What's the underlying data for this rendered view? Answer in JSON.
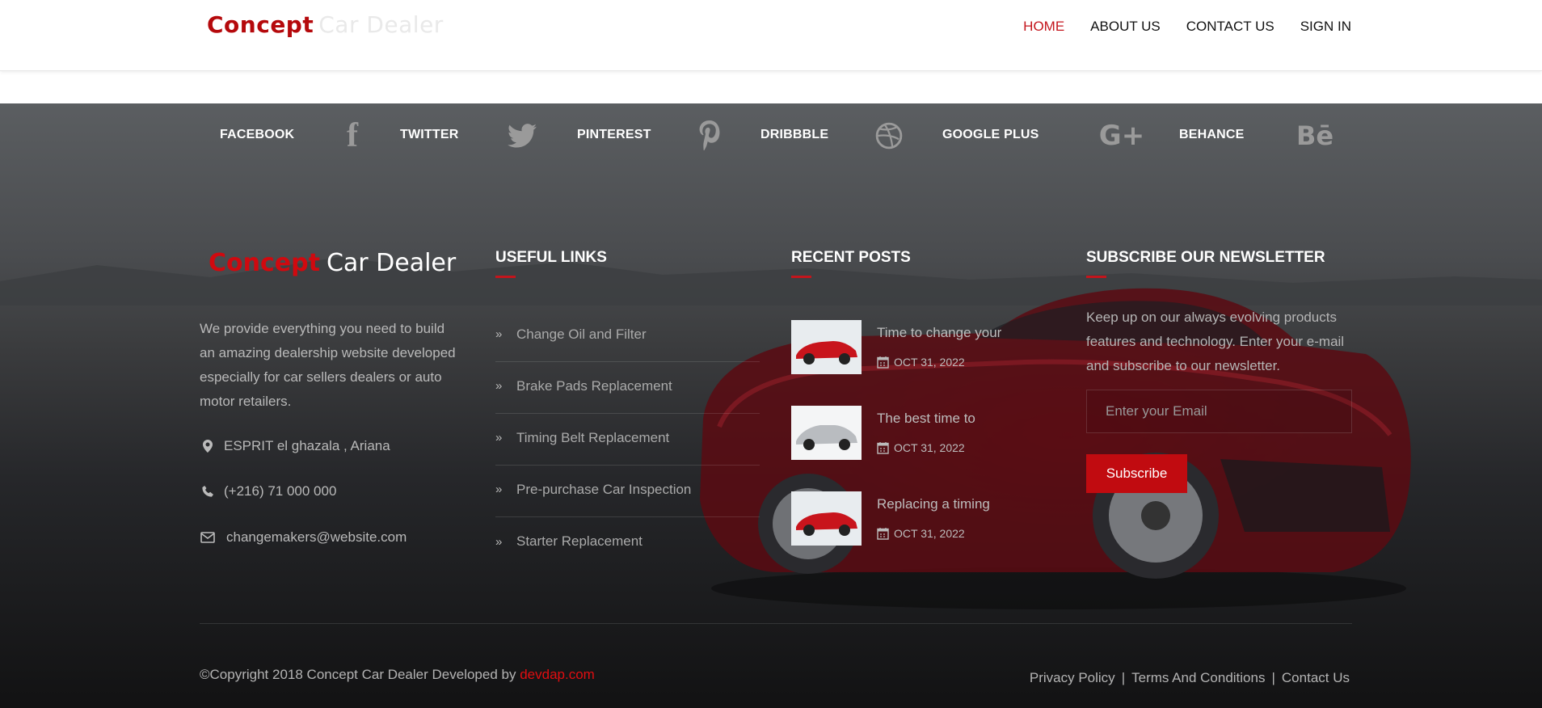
{
  "header": {
    "logo_primary": "Concept",
    "logo_secondary": "Car Dealer",
    "nav": [
      {
        "label": "HOME",
        "active": true
      },
      {
        "label": "ABOUT US"
      },
      {
        "label": "CONTACT US"
      },
      {
        "label": "SIGN IN"
      }
    ]
  },
  "social": [
    {
      "label": "FACEBOOK",
      "icon": "facebook-icon"
    },
    {
      "label": "TWITTER",
      "icon": "twitter-icon"
    },
    {
      "label": "PINTEREST",
      "icon": "pinterest-icon"
    },
    {
      "label": "DRIBBBLE",
      "icon": "dribbble-icon"
    },
    {
      "label": "GOOGLE PLUS",
      "icon": "google-plus-icon"
    },
    {
      "label": "BEHANCE",
      "icon": "behance-icon"
    }
  ],
  "footer": {
    "logo_primary": "Concept",
    "logo_secondary": "Car Dealer",
    "about": "We provide everything you need to build an amazing dealership website developed especially for car sellers dealers or auto motor retailers.",
    "address": "ESPRIT el ghazala , Ariana",
    "phone": "(+216) 71 000 000",
    "email": "changemakers@website.com",
    "useful_links_title": "USEFUL LINKS",
    "useful_links": [
      "Change Oil and Filter",
      "Brake Pads Replacement",
      "Timing Belt Replacement",
      "Pre-purchase Car Inspection",
      "Starter Replacement"
    ],
    "recent_posts_title": "RECENT POSTS",
    "recent_posts": [
      {
        "title": "Time to change your",
        "date": "OCT 31, 2022",
        "car_color": "#c8141c"
      },
      {
        "title": "The best time to",
        "date": "OCT 31, 2022",
        "car_color": "#b9bcc0"
      },
      {
        "title": "Replacing a timing",
        "date": "OCT 31, 2022",
        "car_color": "#c8141c"
      }
    ],
    "newsletter_title": "SUBSCRIBE OUR NEWSLETTER",
    "newsletter_text": "Keep up on our always evolving products features and technology. Enter your e-mail and subscribe to our newsletter.",
    "email_placeholder": "Enter your Email",
    "subscribe_label": "Subscribe",
    "copyright_text": "©Copyright 2018 Concept Car Dealer Developed by ",
    "copyright_link": "devdap.com",
    "legal_links": [
      "Privacy Policy",
      "Terms And Conditions",
      "Contact Us"
    ],
    "legal_separator": "|"
  },
  "colors": {
    "accent": "#c4151c",
    "header_bg": "#ffffff",
    "footer_text": "#b9b9b9"
  }
}
